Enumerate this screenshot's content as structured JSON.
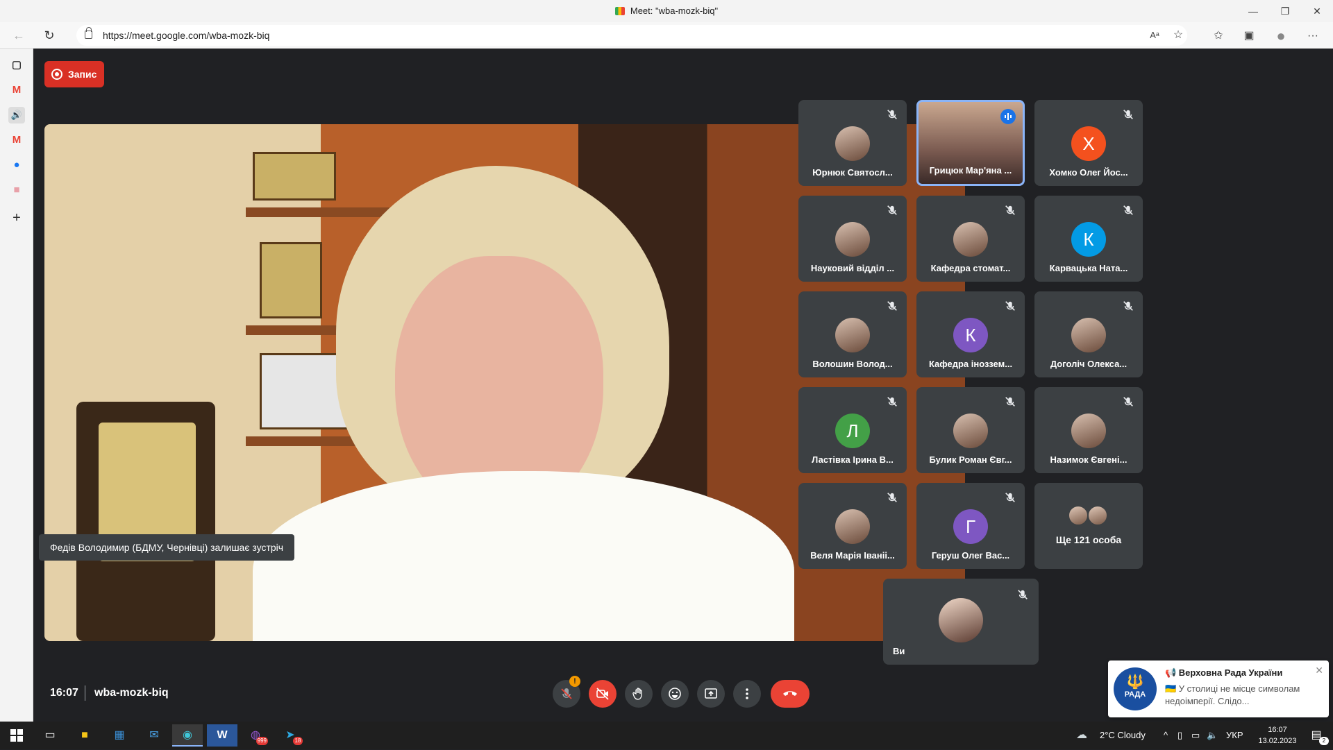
{
  "window": {
    "title": "Meet: \"wba-mozk-biq\"",
    "minimize_glyph": "—",
    "restore_glyph": "❐",
    "close_glyph": "✕"
  },
  "browser": {
    "url": "https://meet.google.com/wba-mozk-biq",
    "nav_back_icon": "←",
    "nav_reload_icon": "↻",
    "read_aloud_label": "Aᵃ",
    "favorite_icon": "☆",
    "favorites_icon": "✩",
    "collections_icon": "▣",
    "profile_icon": "●",
    "menu_icon": "···"
  },
  "sidebar": {
    "items": [
      {
        "icon": "tabs-icon",
        "glyph": "▢",
        "color": "#333333"
      },
      {
        "icon": "gmail-icon",
        "glyph": "M",
        "color": "#ea4335"
      },
      {
        "icon": "speaker-icon",
        "glyph": "🔊",
        "color": "#333333"
      },
      {
        "icon": "gmail-icon",
        "glyph": "M",
        "color": "#ea4335"
      },
      {
        "icon": "messenger-icon",
        "glyph": "●",
        "color": "#1877f2"
      },
      {
        "icon": "app-icon",
        "glyph": "■",
        "color": "#e8a0a8"
      },
      {
        "icon": "add-icon",
        "glyph": "+",
        "color": "#333333"
      }
    ]
  },
  "meet": {
    "record_label": "Запис",
    "toast": "Федів Володимир (БДМУ, Чернівці) залишає зустріч",
    "time": "16:07",
    "meeting_code": "wba-mozk-biq",
    "participants": [
      {
        "name": "Юрнюк Святосл...",
        "avatar_type": "photo",
        "letter": "",
        "color": "",
        "muted": true
      },
      {
        "name": "Грицюк Мар'яна ...",
        "avatar_type": "video",
        "letter": "",
        "color": "",
        "muted": false,
        "speaking": true
      },
      {
        "name": "Хомко Олег Йос...",
        "avatar_type": "letter",
        "letter": "Х",
        "color": "#f4511e",
        "muted": true
      },
      {
        "name": "Науковий відділ ...",
        "avatar_type": "photo",
        "letter": "",
        "color": "",
        "muted": true
      },
      {
        "name": "Кафедра стомат...",
        "avatar_type": "photo",
        "letter": "",
        "color": "",
        "muted": true
      },
      {
        "name": "Карвацька Ната...",
        "avatar_type": "letter",
        "letter": "К",
        "color": "#039be5",
        "muted": true
      },
      {
        "name": "Волошин Волод...",
        "avatar_type": "photo",
        "letter": "",
        "color": "",
        "muted": true
      },
      {
        "name": "Кафедра іноззем...",
        "avatar_type": "letter",
        "letter": "К",
        "color": "#7e57c2",
        "muted": true
      },
      {
        "name": "Доголіч Олекса...",
        "avatar_type": "photo",
        "letter": "",
        "color": "",
        "muted": true
      },
      {
        "name": "Ластівка Ірина В...",
        "avatar_type": "letter",
        "letter": "Л",
        "color": "#43a047",
        "muted": true
      },
      {
        "name": "Булик Роман Євг...",
        "avatar_type": "photo",
        "letter": "",
        "color": "",
        "muted": true
      },
      {
        "name": "Назимок Євгені...",
        "avatar_type": "photo",
        "letter": "",
        "color": "",
        "muted": true
      },
      {
        "name": "Веля Марія Іваніі...",
        "avatar_type": "photo",
        "letter": "",
        "color": "",
        "muted": true
      },
      {
        "name": "Геруш Олег Вас...",
        "avatar_type": "letter",
        "letter": "Г",
        "color": "#7e57c2",
        "muted": true
      }
    ],
    "more": {
      "label": "Ще 121 особа"
    },
    "self": {
      "name": "Ви"
    },
    "controls": {
      "mic_warning": "!"
    }
  },
  "notification": {
    "title": "📢 Верховна Рада України",
    "body": "🇺🇦 У столиці не місце символам недоімперії. Слідо...",
    "logo_text": "РАДА",
    "logo_glyph": "🔱",
    "close_glyph": "✕"
  },
  "taskbar": {
    "weather": "2°C  Cloudy",
    "language": "УКР",
    "time": "16:07",
    "date": "13.02.2023",
    "notification_count": "2",
    "viber_badge": "999",
    "telegram_badge": "18"
  }
}
